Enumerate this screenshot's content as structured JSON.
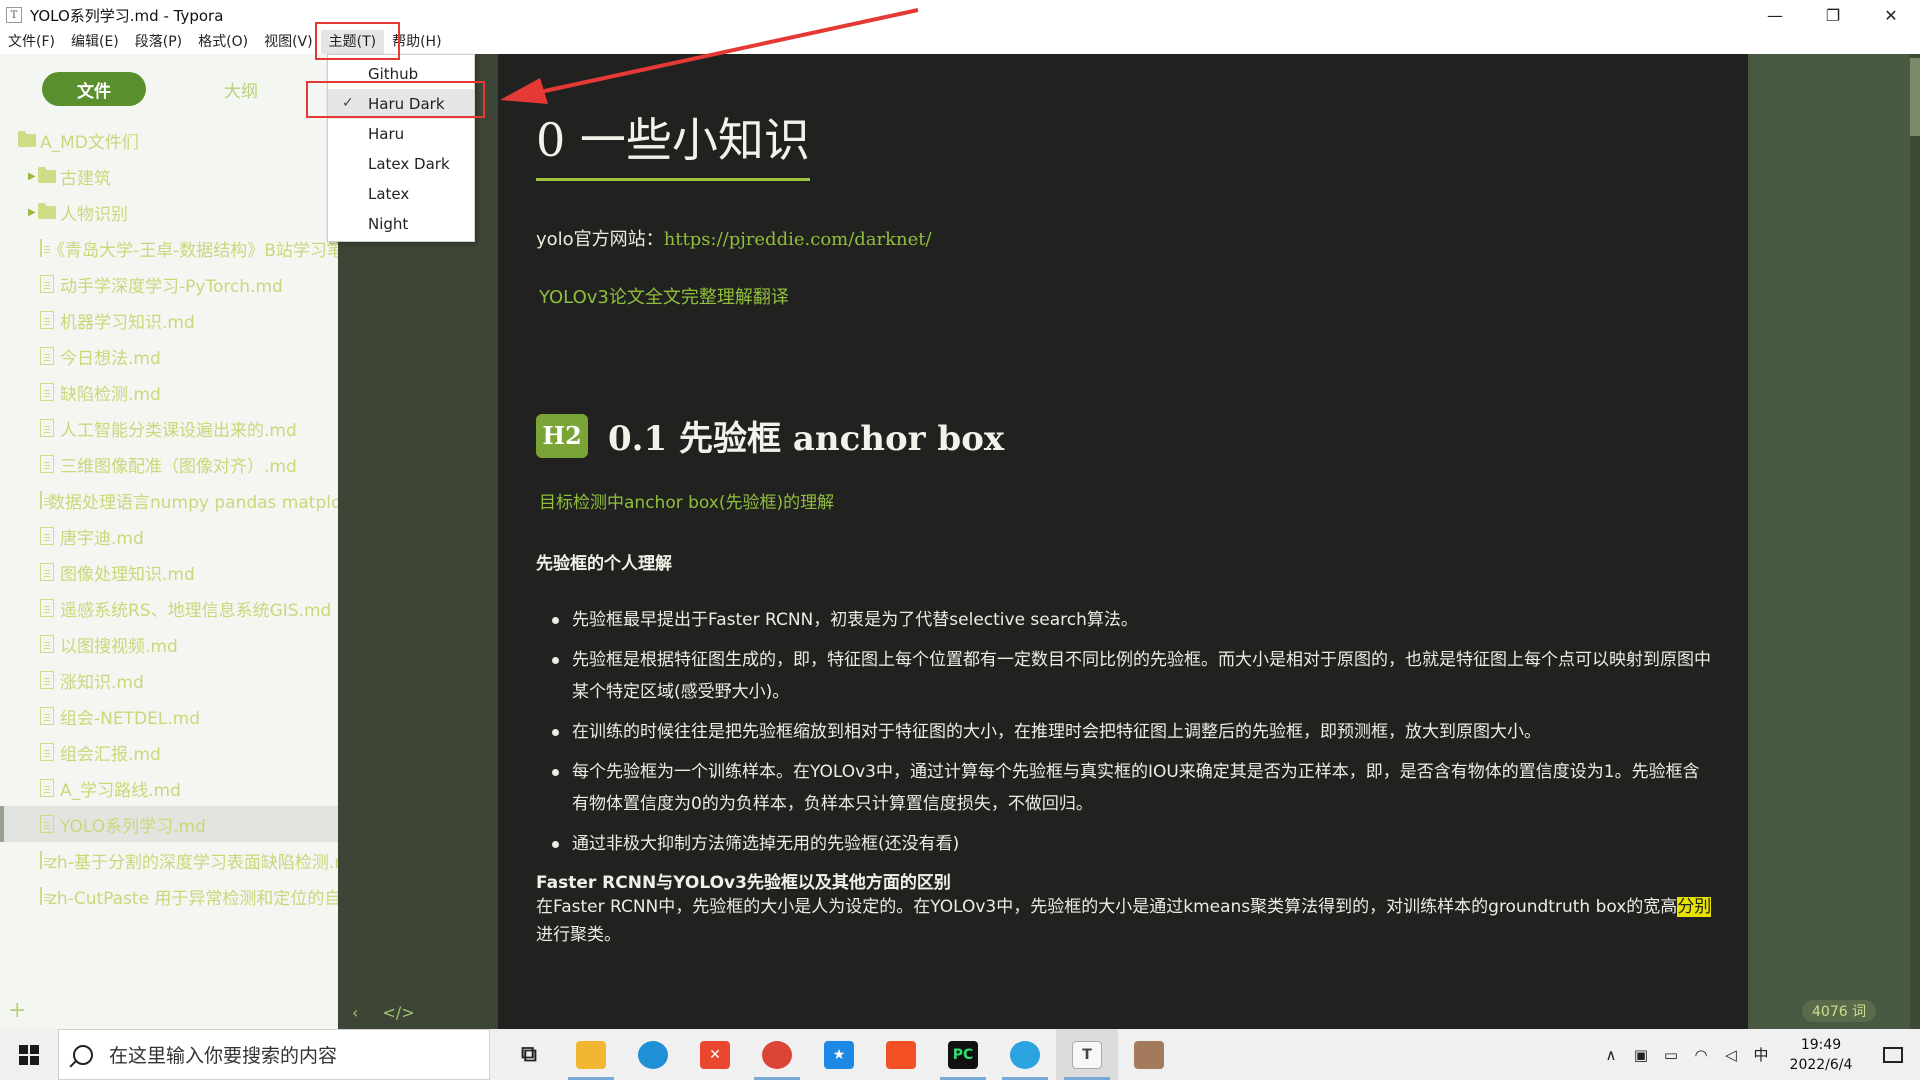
{
  "window": {
    "title": "YOLO系列学习.md - Typora",
    "app_icon_letter": "T"
  },
  "menu": {
    "items": [
      {
        "label": "文件(F)"
      },
      {
        "label": "编辑(E)"
      },
      {
        "label": "段落(P)"
      },
      {
        "label": "格式(O)"
      },
      {
        "label": "视图(V)"
      },
      {
        "label": "主题(T)"
      },
      {
        "label": "帮助(H)"
      }
    ]
  },
  "theme_menu": {
    "items": [
      {
        "label": "Github",
        "checked": false
      },
      {
        "label": "Haru Dark",
        "checked": true
      },
      {
        "label": "Haru",
        "checked": false
      },
      {
        "label": "Latex Dark",
        "checked": false
      },
      {
        "label": "Latex",
        "checked": false
      },
      {
        "label": "Night",
        "checked": false
      }
    ]
  },
  "sidebar": {
    "tab_files": "文件",
    "tab_outline": "大纲",
    "root_folder": "A_MD文件们",
    "subfolders": [
      "古建筑",
      "人物识别"
    ],
    "files": [
      "《青岛大学-王卓-数据结构》B站学习笔记.md",
      "动手学深度学习-PyTorch.md",
      "机器学习知识.md",
      "今日想法.md",
      "缺陷检测.md",
      "人工智能分类课设遍出来的.md",
      "三维图像配准（图像对齐）.md",
      "数据处理语言numpy pandas matplotlib.md",
      "唐宇迪.md",
      "图像处理知识.md",
      "遥感系统RS、地理信息系统GIS.md",
      "以图搜视频.md",
      "涨知识.md",
      "组会-NETDEL.md",
      "组会汇报.md",
      "A_学习路线.md",
      "YOLO系列学习.md",
      "zh-基于分割的深度学习表面缺陷检测.md",
      "zh-CutPaste 用于异常检测和定位的自监督学习.md"
    ],
    "selected_file": "YOLO系列学习.md",
    "add_symbol": "+"
  },
  "editor": {
    "h1": "0 一些小知识",
    "link_label": "yolo官方网站：",
    "link_url": "https://pjreddie.com/darknet/",
    "link2": "YOLOv3论文全文完整理解翻译",
    "h2_badge": "H2",
    "h2": "0.1 先验框 anchor box",
    "sub_link": "目标检测中anchor box(先验框)的理解",
    "section_title": "先验框的个人理解",
    "bullets": [
      "先验框最早提出于Faster RCNN，初衷是为了代替selective search算法。",
      "先验框是根据特征图生成的，即，特征图上每个位置都有一定数目不同比例的先验框。而大小是相对于原图的，也就是特征图上每个点可以映射到原图中某个特定区域(感受野大小)。",
      "在训练的时候往往是把先验框缩放到相对于特征图的大小，在推理时会把特征图上调整后的先验框，即预测框，放大到原图大小。",
      "每个先验框为一个训练样本。在YOLOv3中，通过计算每个先验框与真实框的IOU来确定其是否为正样本，即，是否含有物体的置信度设为1。先验框含有物体置信度为0的为负样本，负样本只计算置信度损失，不做回归。",
      "通过非极大抑制方法筛选掉无用的先验框(还没有看)"
    ],
    "compare_title": "Faster RCNN与YOLOv3先验框以及其他方面的区别",
    "compare_text_before": "在Faster RCNN中，先验框的大小是人为设定的。在YOLOv3中，先验框的大小是通过kmeans聚类算法得到的，对训练样本的groundtruth box的宽高",
    "compare_highlight": "分别",
    "compare_text_after": "进行聚类。",
    "footer_left_icon": "‹",
    "footer_code_icon": "</>",
    "word_count": "4076 词"
  },
  "taskbar": {
    "search_placeholder": "在这里输入你要搜索的内容",
    "time": "19:49",
    "date": "2022/6/4",
    "ime": "中"
  }
}
